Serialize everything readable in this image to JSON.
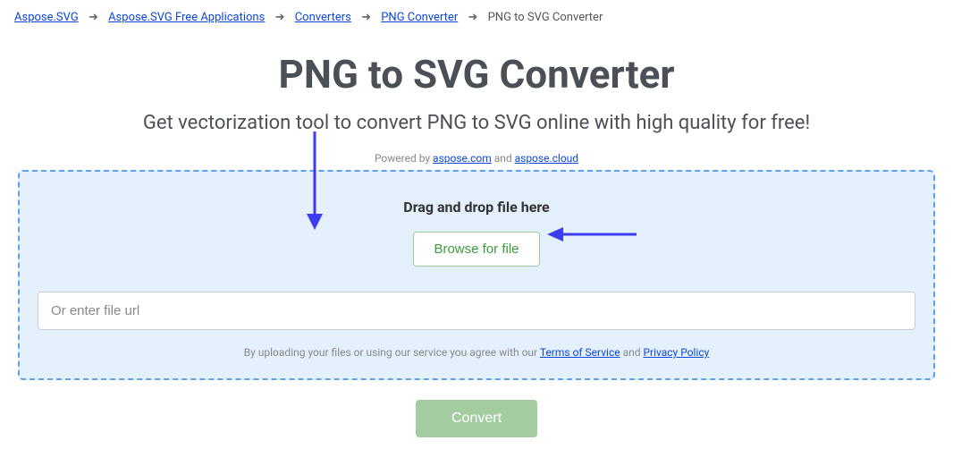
{
  "breadcrumb": {
    "items": [
      {
        "label": "Aspose.SVG"
      },
      {
        "label": "Aspose.SVG Free Applications"
      },
      {
        "label": "Converters"
      },
      {
        "label": "PNG Converter"
      }
    ],
    "current": "PNG to SVG Converter",
    "separator": "➜"
  },
  "header": {
    "title": "PNG to SVG Converter",
    "subtitle": "Get vectorization tool to convert PNG to SVG online with high quality for free!"
  },
  "powered": {
    "prefix": "Powered by ",
    "link1": "aspose.com",
    "and": " and ",
    "link2": "aspose.cloud"
  },
  "dropzone": {
    "drag_text": "Drag and drop file here",
    "browse_label": "Browse for file",
    "url_placeholder": "Or enter file url"
  },
  "terms": {
    "prefix": "By uploading your files or using our service you agree with our ",
    "tos": "Terms of Service",
    "and": " and ",
    "privacy": "Privacy Policy"
  },
  "actions": {
    "convert_label": "Convert"
  },
  "colors": {
    "link": "#0d47d9",
    "dropzone_bg": "#e4f1fd",
    "dropzone_border": "#5fa2e6",
    "browse_text": "#3b9e3b",
    "convert_bg": "#a3cda0",
    "arrow": "#3d3cf0"
  }
}
